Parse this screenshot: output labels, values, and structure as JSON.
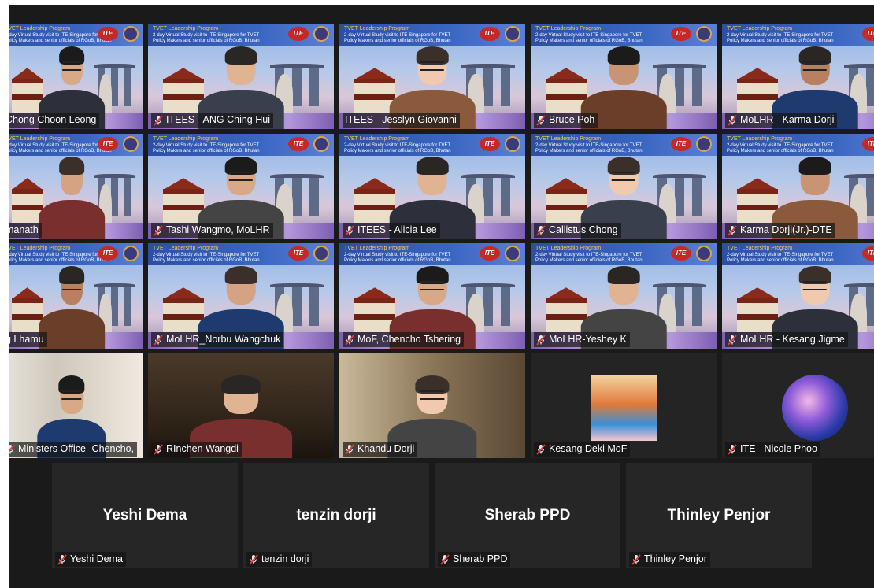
{
  "banner": {
    "line1": "TVET Leadership Program",
    "line2": "2-day Virtual Study visit to ITE-Singapore for TVET",
    "line3": "Policy Makers and senior officials of RGoB, Bhutan",
    "ite_logo": "ITE"
  },
  "colors": {
    "active_speaker_border": "#a7d24c",
    "mic_muted": "#e53935",
    "tile_bg": "#242424",
    "stage_bg": "#1a1a1a"
  },
  "icons": {
    "muted": "muted-microphone-icon"
  },
  "rows": [
    [
      {
        "name": "Chong Choon Leong",
        "muted": false
      },
      {
        "name": "ITEES - ANG Ching Hui",
        "muted": true
      },
      {
        "name": "ITEES - Jesslyn Giovanni",
        "muted": false,
        "active": true
      },
      {
        "name": "Bruce Poh",
        "muted": true
      },
      {
        "name": "MoLHR - Karma Dorji",
        "muted": true
      }
    ],
    [
      {
        "name": "manath",
        "muted": false
      },
      {
        "name": "Tashi Wangmo, MoLHR",
        "muted": true
      },
      {
        "name": "ITEES - Alicia Lee",
        "muted": true
      },
      {
        "name": "Callistus Chong",
        "muted": true
      },
      {
        "name": "Karma Dorji(Jr.)-DTE",
        "muted": true
      }
    ],
    [
      {
        "name": "g Lhamu",
        "muted": false
      },
      {
        "name": "MoLHR_Norbu Wangchuk",
        "muted": true
      },
      {
        "name": "MoF, Chencho Tshering",
        "muted": true
      },
      {
        "name": "MoLHR-Yeshey K",
        "muted": true
      },
      {
        "name": "MoLHR - Kesang Jigme",
        "muted": true
      }
    ],
    [
      {
        "name": "Ministers Office- Chencho,",
        "muted": true
      },
      {
        "name": "RInchen Wangdi",
        "muted": true
      },
      {
        "name": "Khandu Dorji",
        "muted": true
      },
      {
        "name": "Kesang Deki MoF",
        "muted": true
      },
      {
        "name": "ITE - Nicole Phoo",
        "muted": true
      }
    ]
  ],
  "no_video": [
    {
      "display": "Yeshi Dema",
      "label": "Yeshi Dema"
    },
    {
      "display": "tenzin dorji",
      "label": "tenzin dorji"
    },
    {
      "display": "Sherab PPD",
      "label": "Sherab PPD"
    },
    {
      "display": "Thinley Penjor",
      "label": "Thinley Penjor"
    }
  ]
}
